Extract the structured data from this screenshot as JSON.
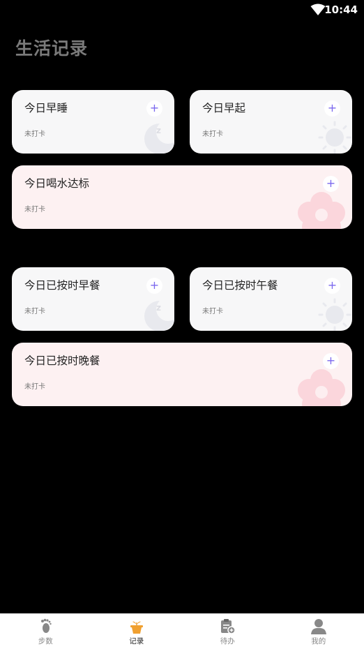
{
  "status_bar": {
    "time": "10:44"
  },
  "page": {
    "title": "生活记录"
  },
  "cards": {
    "sleep_early": {
      "title": "今日早睡",
      "status": "未打卡",
      "plus": "+"
    },
    "wake_early": {
      "title": "今日早起",
      "status": "未打卡",
      "plus": "+"
    },
    "water": {
      "title": "今日喝水达标",
      "status": "未打卡",
      "plus": "+"
    },
    "breakfast": {
      "title": "今日已按时早餐",
      "status": "未打卡",
      "plus": "+"
    },
    "lunch": {
      "title": "今日已按时午餐",
      "status": "未打卡",
      "plus": "+"
    },
    "dinner": {
      "title": "今日已按时晚餐",
      "status": "未打卡",
      "plus": "+"
    }
  },
  "bottom_nav": {
    "items": [
      {
        "label": "步数",
        "icon": "footprint-icon"
      },
      {
        "label": "记录",
        "icon": "pot-plant-icon",
        "active": true
      },
      {
        "label": "待办",
        "icon": "clipboard-add-icon"
      },
      {
        "label": "我的",
        "icon": "person-icon"
      }
    ]
  },
  "colors": {
    "accent": "#7b68ee",
    "active_tab": "#f0a030",
    "card_white": "#f7f7f8",
    "card_pink": "#fdf1f2"
  }
}
